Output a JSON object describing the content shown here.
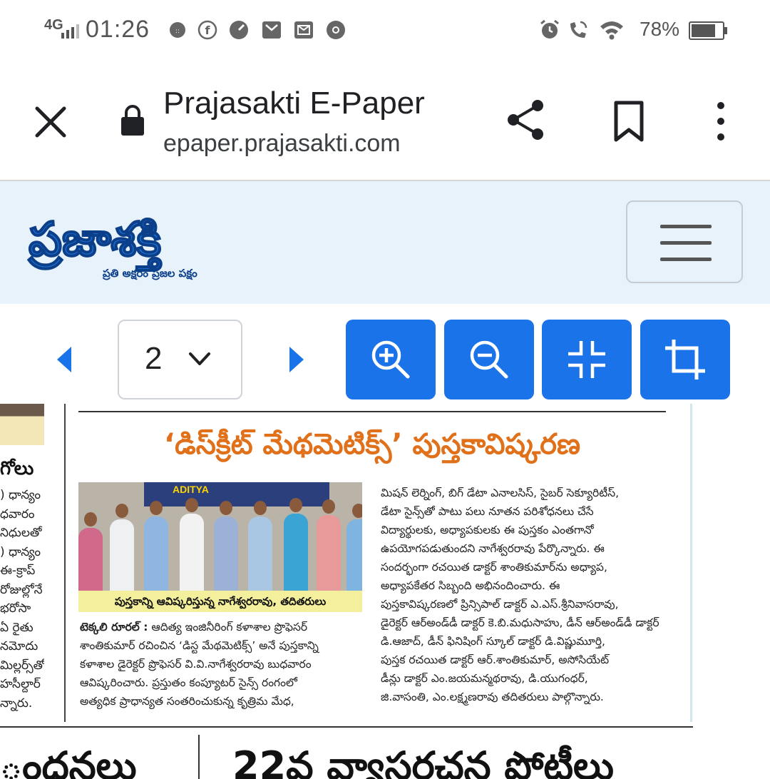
{
  "status_bar": {
    "network": "4G",
    "time": "01:26",
    "battery_percent": "78%",
    "battery_level": 0.78,
    "notification_icons": [
      "vpn-icon",
      "facebook-icon",
      "speed-icon",
      "mail-icon",
      "inbox-icon",
      "chrome-icon"
    ],
    "system_icons": [
      "alarm-icon",
      "wifi-calling-icon",
      "wifi-icon"
    ]
  },
  "browser": {
    "title": "Prajasakti E-Paper",
    "url": "epaper.prajasakti.com"
  },
  "site": {
    "logo_text": "ప్రజాశక్తి",
    "logo_tagline": "ప్రతి అక్షరం ప్రజల పక్షం"
  },
  "viewer": {
    "page_number": "2",
    "tools": [
      "zoom-in-icon",
      "zoom-out-icon",
      "fit-screen-icon",
      "crop-icon"
    ],
    "accent_color": "#1a73e8"
  },
  "paper": {
    "left_column": {
      "heading": "గోలు",
      "lines": [
        ") ధాన్యం",
        "ధవారం",
        "నిధులతో",
        ") ధాన్యం",
        "ఈ-క్రాప్",
        "రోజుల్లోనే",
        "భరోసా",
        "ఏ రైతు",
        "నమోదు",
        "మిల్లర్స్‌తో",
        "హసీల్దార్",
        "న్నారు."
      ]
    },
    "article": {
      "headline": "‘డిస్‌క్రీట్ మేథమెటిక్స్’ పుస్తకావిష్కరణ",
      "photo_banner": "ADITYA",
      "caption": "పుస్తకాన్ని ఆవిష్కరిస్తున్న నాగేశ్వరరావు, తదితరులు",
      "dateline": "టెక్కలి రూరల్ :",
      "left_lines": [
        "ఆదిత్య ఇంజినీరింగ్ కళాశాల ప్రొఫెసర్",
        "శాంతికుమార్ రచించిన ‘డిస్ట మేథమెటిక్స్’ అనే పుస్తకాన్ని",
        "కళాశాల డైరెక్టర్ ప్రొఫెసర్ వి.వి.నాగేశ్వరరావు బుధవారం",
        "ఆవిష్కరించారు. ప్రస్తుతం కంప్యూటర్ సైన్స్ రంగంలో",
        "అత్యధిక ప్రాధాన్యత సంతరించుకున్న కృత్రిమ మేధ,"
      ],
      "right_lines": [
        "మిషన్ లెర్నింగ్, బిగ్ డేటా ఎనాలసిస్, సైబర్ సెక్యూరిటీస్,",
        "డేటా సైన్స్‌తో పాటు పలు నూతన పరిశోధనలు చేసే",
        "విద్యార్థులకు, అధ్యాపకులకు ఈ పుస్తకం ఎంతగానో",
        "ఉపయోగపడుతుందని నాగేశ్వరరావు పేర్కొన్నారు. ఈ",
        "సందర్భంగా రచయిత డాక్టర్ శాంతికుమార్‌ను అధ్యాప,",
        "అధ్యాపకేతర సిబ్బంది అభినందించారు. ఈ",
        "పుస్తకావిష్కరణలో ప్రిన్సిపాల్ డాక్టర్ ఎ.ఎస్.శ్రీనివాసరావు,",
        "డైరెక్టర్ ఆర్అండ్‌డీ డాక్టర్ కె.బి.మధుసాహు, డీన్ ఆర్అండ్‌డీ డాక్టర్",
        "డి.ఆజాద్, డీన్ ఫినిషింగ్ స్కూల్ డాక్టర్ డి.విష్ణుమూర్తి,",
        "పుస్తక రచయిత డాక్టర్ ఆర్.శాంతికుమార్, అసోసియేట్",
        "డీన్లు డాక్టర్ ఎం.జయమన్మథరావు, డి.యుగంధర్,",
        "జి.వాసంతి, ఎం.లక్ష్మణరావు తదితరులు పాల్గొన్నారు."
      ]
    },
    "bottom": {
      "left_heading": "ంధనలు",
      "right_heading": "22వ వ్యాసరచన పోటీలు"
    }
  }
}
